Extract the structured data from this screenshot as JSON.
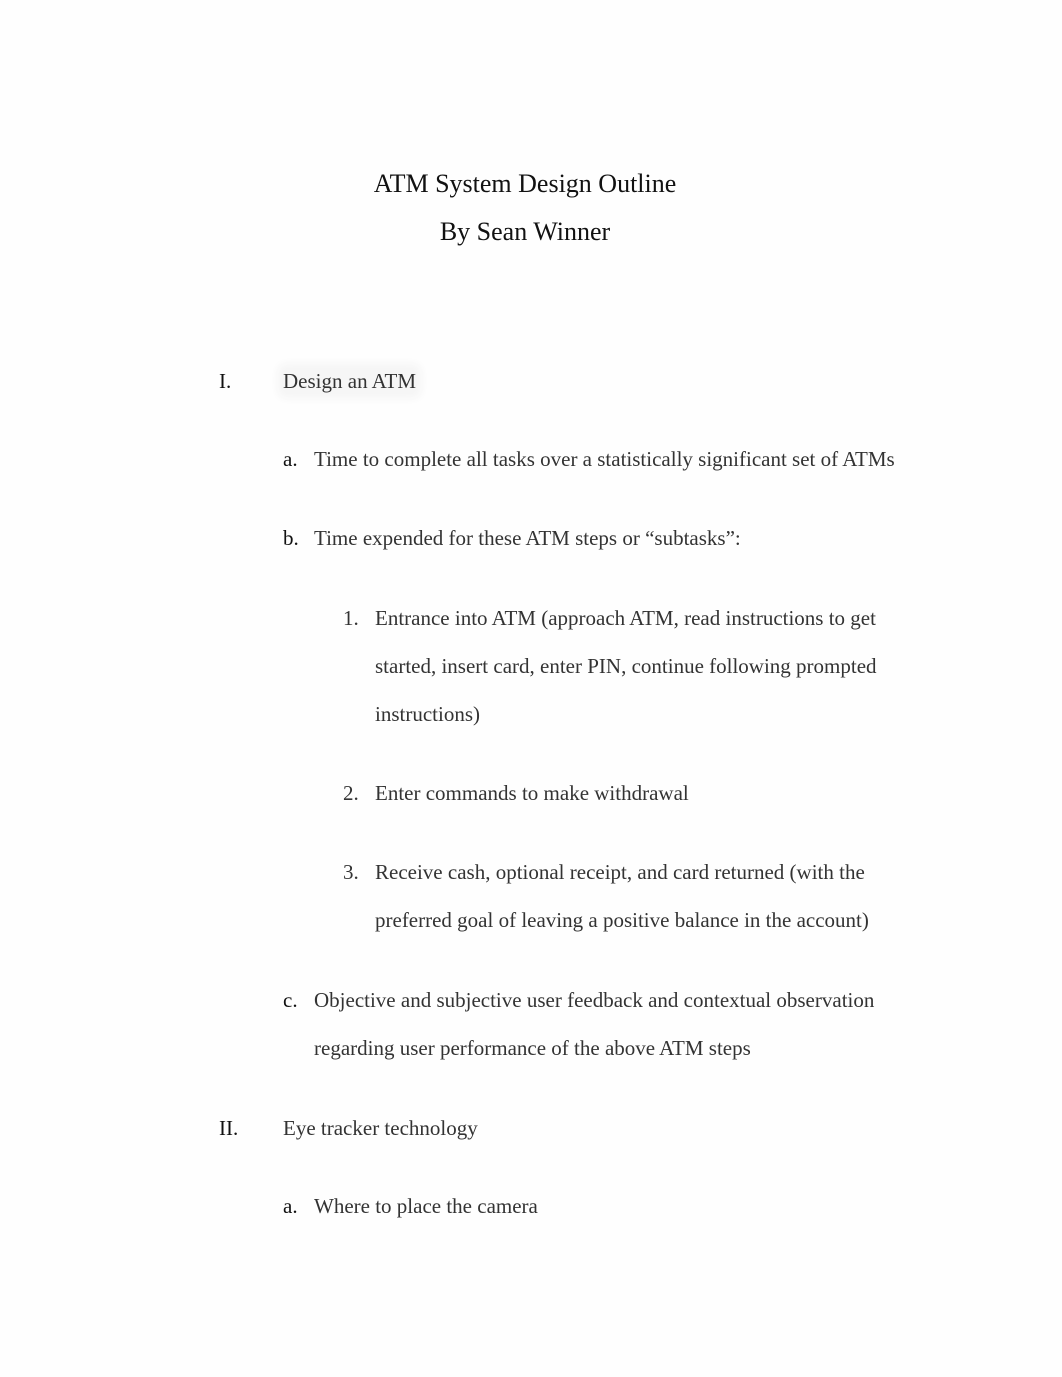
{
  "document": {
    "title": "ATM System Design Outline",
    "author_line": "By Sean Winner"
  },
  "outline": [
    {
      "marker": "I.",
      "text": "Design an ATM",
      "children": [
        {
          "marker": "a.",
          "lines": [
            "Time to complete all tasks over a statistically significant set of ATMs"
          ]
        },
        {
          "marker": "b.",
          "lines": [
            "Time expended for these ATM steps or “subtasks”:"
          ],
          "children": [
            {
              "marker": "1.",
              "lines": [
                "Entrance into ATM (approach ATM, read instructions to get",
                "started, insert card, enter PIN, continue following prompted",
                "instructions)"
              ]
            },
            {
              "marker": "2.",
              "lines": [
                "Enter commands to make withdrawal"
              ]
            },
            {
              "marker": "3.",
              "lines": [
                "Receive cash, optional receipt, and card returned (with the",
                "preferred goal of leaving a positive balance in the account)"
              ]
            }
          ]
        },
        {
          "marker": "c.",
          "lines": [
            "Objective and subjective user feedback and contextual observation",
            "regarding user performance of the above ATM steps"
          ]
        }
      ]
    },
    {
      "marker": "II.",
      "text": "Eye tracker technology",
      "children": [
        {
          "marker": "a.",
          "lines": [
            "Where to place the camera"
          ]
        }
      ]
    }
  ]
}
